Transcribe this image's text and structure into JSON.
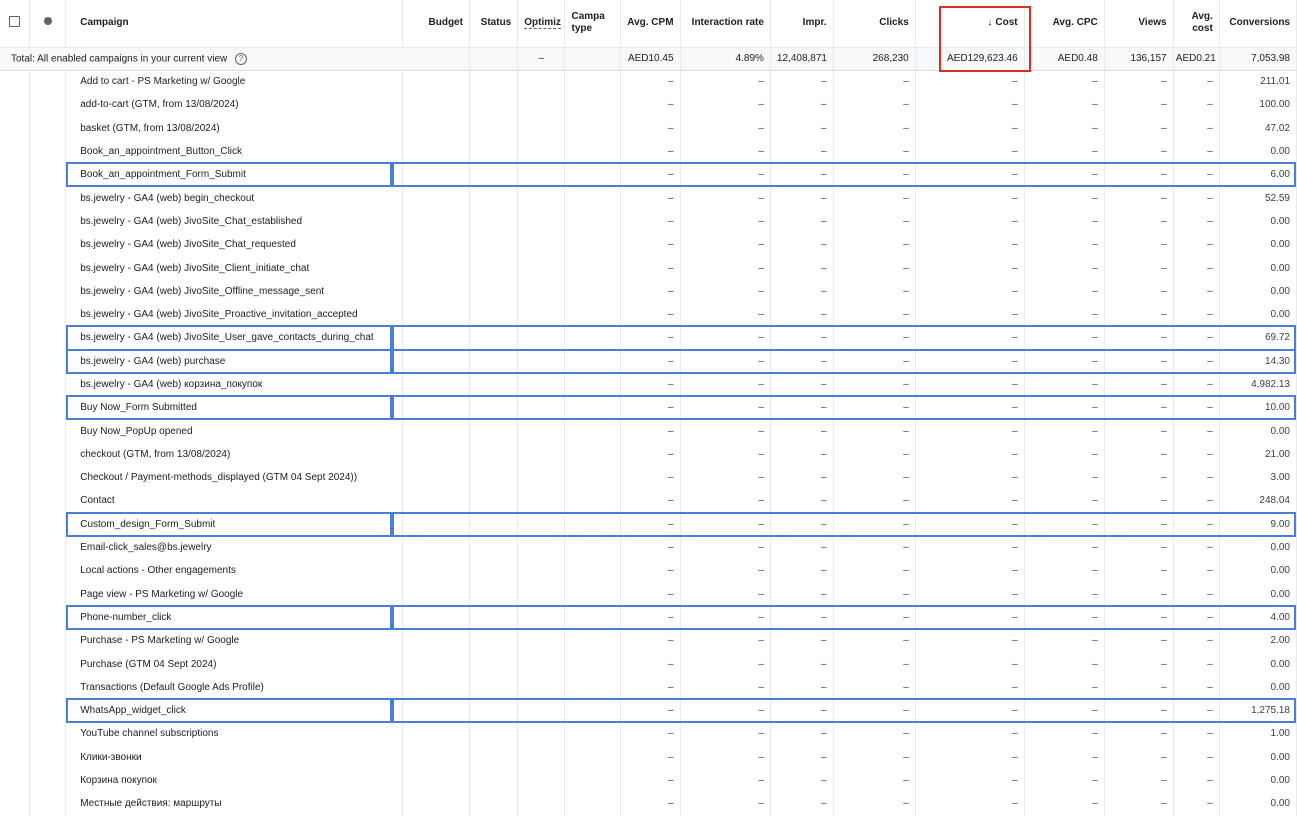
{
  "header": {
    "campaign": "Campaign",
    "budget": "Budget",
    "status": "Status",
    "optimization": "Optimiz",
    "campaign_type_1": "Campa",
    "campaign_type_2": "type",
    "avg_cpm": "Avg. CPM",
    "interaction_rate": "Interaction rate",
    "impr": "Impr.",
    "clicks": "Clicks",
    "cost": "Cost",
    "sort_arrow": "↓",
    "avg_cpc": "Avg. CPC",
    "views": "Views",
    "avg_cost_1": "Avg.",
    "avg_cost_2": "cost",
    "conversions": "Conversions"
  },
  "total": {
    "label": "Total: All enabled campaigns in your current view",
    "help": "?",
    "optimization": "–",
    "avg_cpm": "AED10.45",
    "interaction_rate": "4.89%",
    "impr": "12,408,871",
    "clicks": "268,230",
    "cost": "AED129,623.46",
    "avg_cpc": "AED0.48",
    "views": "136,157",
    "avg_cost": "AED0.21",
    "conversions": "7,053.98"
  },
  "dash": "–",
  "rows": [
    {
      "name": "Add to cart - PS Marketing w/ Google",
      "conversions": "211.01",
      "highlight": false
    },
    {
      "name": "add-to-cart (GTM, from 13/08/2024)",
      "conversions": "100.00",
      "highlight": false
    },
    {
      "name": "basket (GTM, from 13/08/2024)",
      "conversions": "47.02",
      "highlight": false
    },
    {
      "name": "Book_an_appointment_Button_Click",
      "conversions": "0.00",
      "highlight": false
    },
    {
      "name": "Book_an_appointment_Form_Submit",
      "conversions": "6.00",
      "highlight": true
    },
    {
      "name": "bs.jewelry - GA4 (web) begin_checkout",
      "conversions": "52.59",
      "highlight": false
    },
    {
      "name": "bs.jewelry - GA4 (web) JivoSite_Chat_established",
      "conversions": "0.00",
      "highlight": false
    },
    {
      "name": "bs.jewelry - GA4 (web) JivoSite_Chat_requested",
      "conversions": "0.00",
      "highlight": false
    },
    {
      "name": "bs.jewelry - GA4 (web) JivoSite_Client_initiate_chat",
      "conversions": "0.00",
      "highlight": false
    },
    {
      "name": "bs.jewelry - GA4 (web) JivoSite_Offline_message_sent",
      "conversions": "0.00",
      "highlight": false
    },
    {
      "name": "bs.jewelry - GA4 (web) JivoSite_Proactive_invitation_accepted",
      "conversions": "0.00",
      "highlight": false
    },
    {
      "name": "bs.jewelry - GA4 (web) JivoSite_User_gave_contacts_during_chat",
      "conversions": "69.72",
      "highlight": true
    },
    {
      "name": "bs.jewelry - GA4 (web) purchase",
      "conversions": "14.30",
      "highlight": true
    },
    {
      "name": "bs.jewelry - GA4 (web) корзина_покупок",
      "conversions": "4,982.13",
      "highlight": false
    },
    {
      "name": "Buy Now_Form Submitted",
      "conversions": "10.00",
      "highlight": true
    },
    {
      "name": "Buy Now_PopUp opened",
      "conversions": "0.00",
      "highlight": false
    },
    {
      "name": "checkout (GTM, from 13/08/2024)",
      "conversions": "21.00",
      "highlight": false
    },
    {
      "name": "Checkout / Payment-methods_displayed (GTM 04 Sept 2024))",
      "conversions": "3.00",
      "highlight": false
    },
    {
      "name": "Contact",
      "conversions": "248.04",
      "highlight": false
    },
    {
      "name": "Custom_design_Form_Submit",
      "conversions": "9.00",
      "highlight": true
    },
    {
      "name": "Email-click_sales@bs.jewelry",
      "conversions": "0.00",
      "highlight": false
    },
    {
      "name": "Local actions - Other engagements",
      "conversions": "0.00",
      "highlight": false
    },
    {
      "name": "Page view - PS Marketing w/ Google",
      "conversions": "0.00",
      "highlight": false
    },
    {
      "name": "Phone-number_click",
      "conversions": "4.00",
      "highlight": true
    },
    {
      "name": "Purchase - PS Marketing w/ Google",
      "conversions": "2.00",
      "highlight": false
    },
    {
      "name": "Purchase (GTM 04 Sept 2024)",
      "conversions": "0.00",
      "highlight": false
    },
    {
      "name": "Transactions (Default Google Ads Profile)",
      "conversions": "0.00",
      "highlight": false
    },
    {
      "name": "WhatsApp_widget_click",
      "conversions": "1,275.18",
      "highlight": true
    },
    {
      "name": "YouTube channel subscriptions",
      "conversions": "1.00",
      "highlight": false
    },
    {
      "name": "Клики-звонки",
      "conversions": "0.00",
      "highlight": false
    },
    {
      "name": "Корзина покупок",
      "conversions": "0.00",
      "highlight": false
    },
    {
      "name": "Местные действия: маршруты",
      "conversions": "0.00",
      "highlight": false
    }
  ],
  "colors": {
    "highlight_red": "#d93025",
    "highlight_blue": "#4a7fd4",
    "grid": "#e8eaed"
  }
}
